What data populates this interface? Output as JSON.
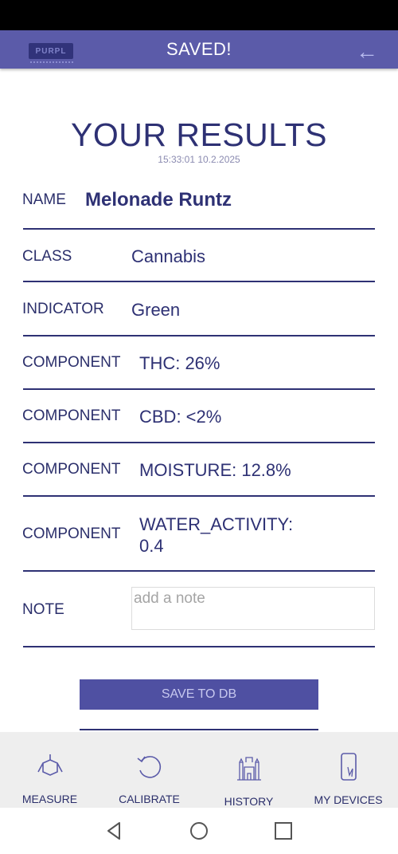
{
  "app_bar": {
    "logo_text": "PURPL",
    "title": "SAVED!",
    "back_icon": "arrow-left-icon"
  },
  "results": {
    "title": "YOUR RESULTS",
    "timestamp": "15:33:01 10.2.2025",
    "rows": [
      {
        "label": "NAME",
        "value": "Melonade Runtz"
      },
      {
        "label": "CLASS",
        "value": "Cannabis"
      },
      {
        "label": "INDICATOR",
        "value": "Green"
      },
      {
        "label": "COMPONENT",
        "value": "THC: 26%"
      },
      {
        "label": "COMPONENT",
        "value": "CBD: <2%"
      },
      {
        "label": "COMPONENT",
        "value": "MOISTURE: 12.8%"
      },
      {
        "label": "COMPONENT",
        "value_line1": "WATER_ACTIVITY:",
        "value_line2": "0.4"
      }
    ],
    "note": {
      "label": "NOTE",
      "placeholder": "add a note",
      "value": ""
    },
    "save_button": "SAVE TO DB"
  },
  "bottom_nav": [
    {
      "label": "MEASURE",
      "icon": "measure-icon"
    },
    {
      "label": "CALIBRATE",
      "icon": "calibrate-icon"
    },
    {
      "label": "HISTORY",
      "icon": "history-icon"
    },
    {
      "label": "MY DEVICES",
      "icon": "devices-icon"
    }
  ],
  "system_nav": [
    "back-triangle-icon",
    "home-circle-icon",
    "recents-square-icon"
  ],
  "colors": {
    "accent": "#5b5ba9",
    "text": "#2e3174",
    "button": "#4f50a2",
    "nav_bg": "#eeeeee"
  }
}
